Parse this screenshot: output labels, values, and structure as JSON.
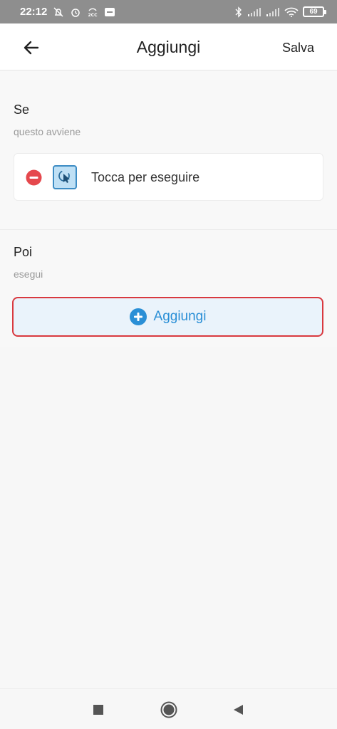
{
  "status_bar": {
    "time": "22:12",
    "battery": "69",
    "icons": [
      "notifications-off-icon",
      "alarm-icon",
      "2cc-icon",
      "app-notification-icon",
      "bluetooth-icon",
      "signal-icon",
      "signal-icon",
      "wifi-icon",
      "battery-icon"
    ]
  },
  "app_bar": {
    "back_icon": "arrow-left-icon",
    "title": "Aggiungi",
    "save_label": "Salva"
  },
  "if_section": {
    "title": "Se",
    "subtitle": "questo avviene",
    "trigger": {
      "remove_icon": "remove-circle-icon",
      "icon": "tap-icon",
      "label": "Tocca per eseguire"
    }
  },
  "then_section": {
    "title": "Poi",
    "subtitle": "esegui",
    "add_button": {
      "icon": "plus-circle-icon",
      "label": "Aggiungi"
    }
  },
  "colors": {
    "accent": "#2a8fd6",
    "highlight_border": "#d9393f",
    "remove_red": "#e5484d"
  },
  "nav_bar": {
    "buttons": [
      "recents-square-icon",
      "home-circle-icon",
      "back-triangle-icon"
    ]
  }
}
